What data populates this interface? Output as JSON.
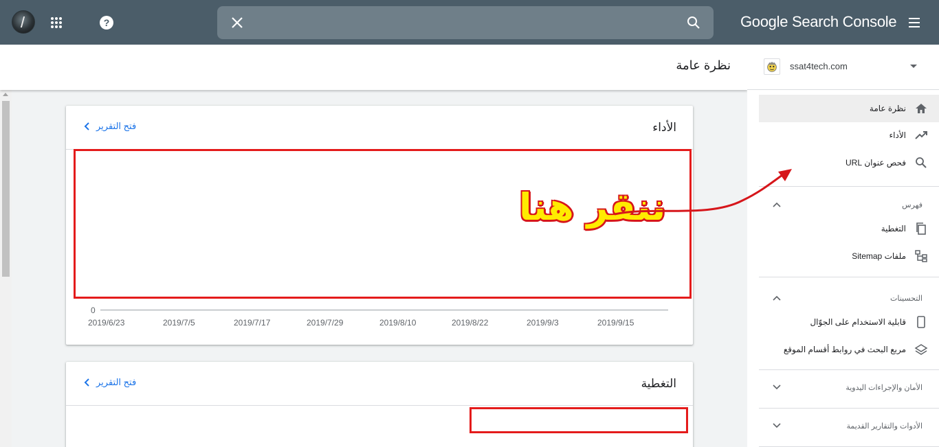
{
  "topbar": {
    "brand": "Google Search Console",
    "search": {
      "value": "",
      "placeholder": ""
    }
  },
  "page": {
    "title": "نظرة عامة"
  },
  "performance_card": {
    "title": "الأداء",
    "open_report": "فتح التقرير",
    "y_zero": "0",
    "x_ticks": [
      "2019/6/23",
      "2019/7/5",
      "2019/7/17",
      "2019/7/29",
      "2019/8/10",
      "2019/8/22",
      "2019/9/3",
      "2019/9/15"
    ]
  },
  "coverage_card": {
    "title": "التغطية",
    "open_report": "فتح التقرير"
  },
  "annotation": {
    "text": "ننقر هنا",
    "color": "#e41b1b"
  },
  "sidebar": {
    "property": "ssat4tech.com",
    "items": [
      {
        "label": "نظرة عامة",
        "icon": "home-icon"
      },
      {
        "label": "الأداء",
        "icon": "trending-up-icon"
      },
      {
        "label": "فحص عنوان URL",
        "icon": "search-icon"
      }
    ],
    "index_section": {
      "label": "فهرس",
      "items": [
        {
          "label": "التغطية",
          "icon": "copy-icon"
        },
        {
          "label": "ملفات Sitemap",
          "icon": "sitemap-icon"
        }
      ]
    },
    "enhancements_section": {
      "label": "التحسينات",
      "items": [
        {
          "label": "قابلية الاستخدام على الجوّال",
          "icon": "smartphone-icon"
        },
        {
          "label": "مربع البحث في روابط أقسام الموقع",
          "icon": "layers-icon"
        }
      ]
    },
    "security_section": {
      "label": "الأمان والإجراءات اليدوية"
    },
    "legacy_section": {
      "label": "الأدوات والتقارير القديمة"
    }
  }
}
